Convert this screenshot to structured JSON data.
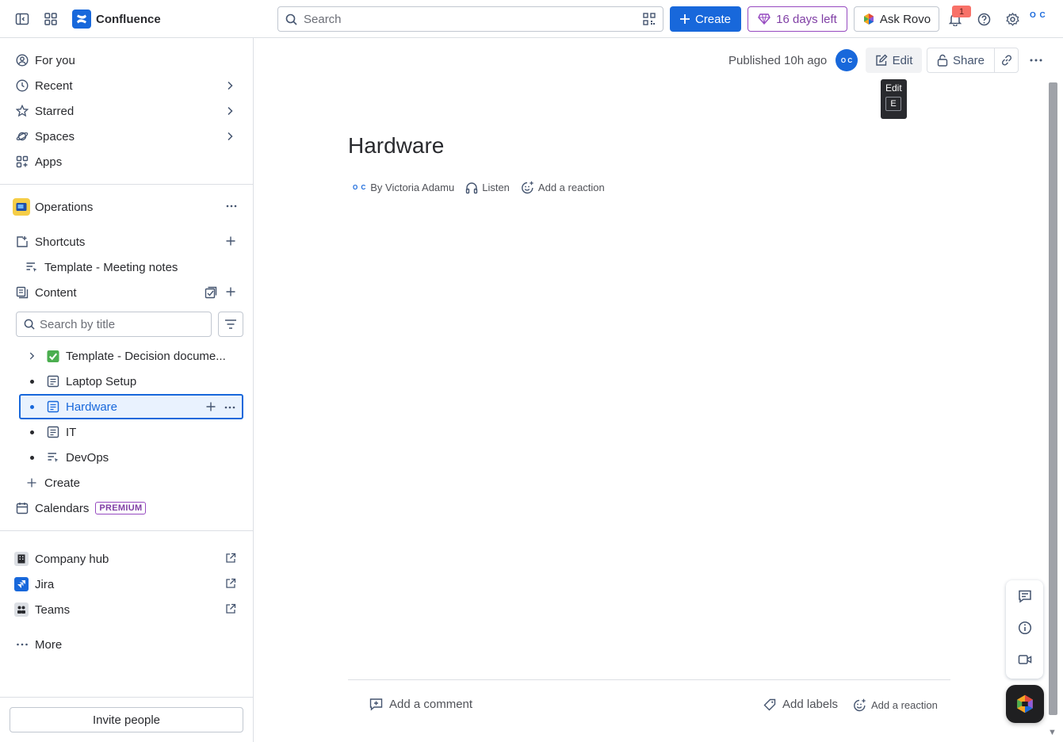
{
  "topbar": {
    "app_name": "Confluence",
    "search_placeholder": "Search",
    "create_label": "Create",
    "trial_label": "16 days left",
    "rovo_label": "Ask Rovo",
    "notification_count": "1",
    "avatar_initials": "O C"
  },
  "sidebar": {
    "nav": [
      {
        "label": "For you",
        "icon": "person-circle-icon"
      },
      {
        "label": "Recent",
        "icon": "clock-icon"
      },
      {
        "label": "Starred",
        "icon": "star-icon"
      },
      {
        "label": "Spaces",
        "icon": "planet-icon"
      },
      {
        "label": "Apps",
        "icon": "apps-icon"
      }
    ],
    "space_name": "Operations",
    "shortcuts_label": "Shortcuts",
    "shortcut_item": "Template - Meeting notes",
    "content_label": "Content",
    "tree_search_placeholder": "Search by title",
    "tree": [
      {
        "label": "Template - Decision docume...",
        "icon": "check-emoji"
      },
      {
        "label": "Laptop Setup",
        "icon": "page-icon"
      },
      {
        "label": "Hardware",
        "icon": "page-icon",
        "selected": true
      },
      {
        "label": "IT",
        "icon": "page-icon"
      },
      {
        "label": "DevOps",
        "icon": "live-doc-icon"
      }
    ],
    "create_label": "Create",
    "calendars_label": "Calendars",
    "premium_label": "PREMIUM",
    "apps": [
      {
        "label": "Company hub"
      },
      {
        "label": "Jira"
      },
      {
        "label": "Teams"
      }
    ],
    "more_label": "More",
    "invite_label": "Invite people"
  },
  "page": {
    "published": "Published 10h ago",
    "owner_initials": "O C",
    "edit_label": "Edit",
    "share_label": "Share",
    "tooltip_title": "Edit",
    "tooltip_key": "E",
    "title": "Hardware",
    "byline_author": "By Victoria Adamu",
    "listen_label": "Listen",
    "reaction_label": "Add a reaction",
    "add_comment": "Add a comment",
    "add_labels": "Add labels",
    "footer_reaction": "Add a reaction"
  },
  "colors": {
    "brand": "#1868db",
    "trial_purple": "#964ac0",
    "selected_bg": "#e9f2fe"
  }
}
